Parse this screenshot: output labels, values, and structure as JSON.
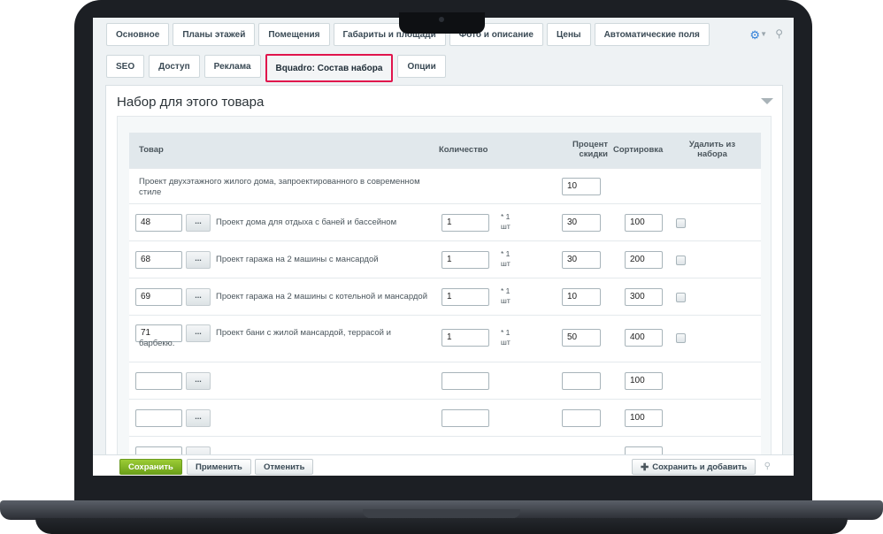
{
  "tabs_row1": [
    "Основное",
    "Планы этажей",
    "Помещения",
    "Габариты и площади",
    "Фото и описание",
    "Цены",
    "Автоматические поля"
  ],
  "tabs_row2": [
    "SEO",
    "Доступ",
    "Реклама",
    "Bquadro: Состав набора",
    "Опции"
  ],
  "active_tab": "Bquadro: Состав набора",
  "icons": {
    "settings": "gear-icon",
    "pin": "pin-icon",
    "collapse": "collapse-triangle-icon"
  },
  "panel_title": "Набор для этого товара",
  "columns": {
    "product": "Товар",
    "quantity": "Количество",
    "discount": "Процент скидки",
    "sort": "Сортировка",
    "delete": "Удалить из набора"
  },
  "main_product": {
    "name": "Проект двухэтажного жилого дома, запроектированного в современном стиле",
    "discount": "10"
  },
  "items": [
    {
      "id": "48",
      "name": "Проект дома для отдыха с баней и бассейном",
      "qty": "1",
      "unit": "* 1 шт",
      "discount": "30",
      "sort": "100"
    },
    {
      "id": "68",
      "name": "Проект гаража на 2 машины с мансардой",
      "qty": "1",
      "unit": "* 1 шт",
      "discount": "30",
      "sort": "200"
    },
    {
      "id": "69",
      "name": "Проект гаража на 2 машины с котельной и мансардой",
      "qty": "1",
      "unit": "* 1 шт",
      "discount": "10",
      "sort": "300"
    },
    {
      "id": "71",
      "name": "Проект бани с жилой мансардой, террасой и барбекю.",
      "qty": "1",
      "unit": "* 1 шт",
      "discount": "50",
      "sort": "400"
    }
  ],
  "empty_rows": [
    {
      "sort": "100"
    },
    {
      "sort": "100"
    }
  ],
  "dots_label": "...",
  "footer": {
    "save": "Сохранить",
    "apply": "Применить",
    "cancel": "Отменить",
    "save_add": "Сохранить и добавить"
  },
  "colors": {
    "active_tab_border": "#e0144c",
    "save_button": "#7ab427",
    "gear": "#2f7fd9"
  }
}
